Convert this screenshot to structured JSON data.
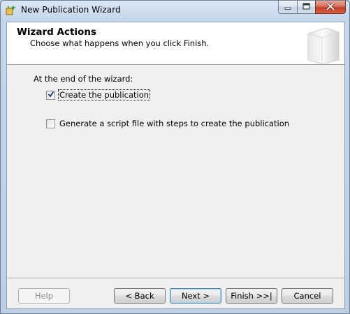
{
  "window": {
    "title": "New Publication Wizard",
    "icons": {
      "app": "wizard-app-icon",
      "minimize": "minimize-icon",
      "maximize": "maximize-icon",
      "close": "close-icon"
    }
  },
  "header": {
    "title": "Wizard Actions",
    "subtitle": "Choose what happens when you click Finish.",
    "graphic": "database-icon"
  },
  "body": {
    "section_label": "At the end of the wizard:",
    "options": [
      {
        "label": "Create the publication",
        "checked": true
      },
      {
        "label": "Generate a script file with steps to create the publication",
        "checked": false
      }
    ]
  },
  "buttons": {
    "help": "Help",
    "back": "< Back",
    "next": "Next >",
    "finish": "Finish >>|",
    "cancel": "Cancel"
  },
  "colors": {
    "title_bar": "#c4d6ea",
    "close_button": "#c23c23",
    "dialog_bg": "#f0f0f0",
    "default_button_border": "#3c7fb1"
  }
}
